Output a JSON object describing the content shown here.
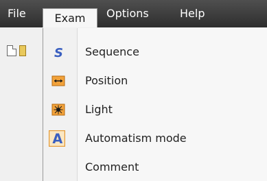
{
  "menubar": {
    "items": [
      {
        "label": "File"
      },
      {
        "label": "Exam"
      },
      {
        "label": "Options"
      },
      {
        "label": "Help"
      }
    ]
  },
  "exam_menu": {
    "items": [
      {
        "label": "Sequence",
        "icon": "sequence-s-icon"
      },
      {
        "label": "Position",
        "icon": "position-arrows-icon"
      },
      {
        "label": "Light",
        "icon": "light-icon"
      },
      {
        "label": "Automatism mode",
        "icon": "automatism-a-icon"
      },
      {
        "label": "Comment",
        "icon": ""
      }
    ]
  },
  "colors": {
    "menubar_bg": "#3b3b3b",
    "menu_bg": "#f7f7f7",
    "accent_blue": "#3a5fc0",
    "highlight_orange": "#f2a23a"
  }
}
